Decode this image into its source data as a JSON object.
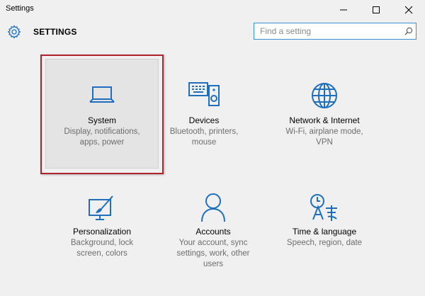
{
  "window": {
    "title": "Settings",
    "controls": {
      "minimize": "minimize",
      "maximize": "maximize",
      "close": "close"
    }
  },
  "header": {
    "title": "SETTINGS",
    "search": {
      "placeholder": "Find a setting",
      "value": ""
    }
  },
  "tiles": [
    {
      "title": "System",
      "desc": [
        "Display, notifications,",
        "apps, power"
      ],
      "icon": "laptop-icon",
      "selected": true
    },
    {
      "title": "Devices",
      "desc": [
        "Bluetooth, printers,",
        "mouse"
      ],
      "icon": "devices-icon"
    },
    {
      "title": "Network & Internet",
      "desc": [
        "Wi-Fi, airplane mode,",
        "VPN"
      ],
      "icon": "globe-icon"
    },
    {
      "title": "Personalization",
      "desc": [
        "Background, lock",
        "screen, colors"
      ],
      "icon": "personalization-icon"
    },
    {
      "title": "Accounts",
      "desc": [
        "Your account, sync",
        "settings, work, other",
        "users"
      ],
      "icon": "person-icon"
    },
    {
      "title": "Time & language",
      "desc": [
        "Speech, region, date"
      ],
      "icon": "time-language-icon"
    }
  ],
  "colors": {
    "accent": "#1e6fbd",
    "selection_border": "#b0232d",
    "background": "#f0f0f0"
  }
}
